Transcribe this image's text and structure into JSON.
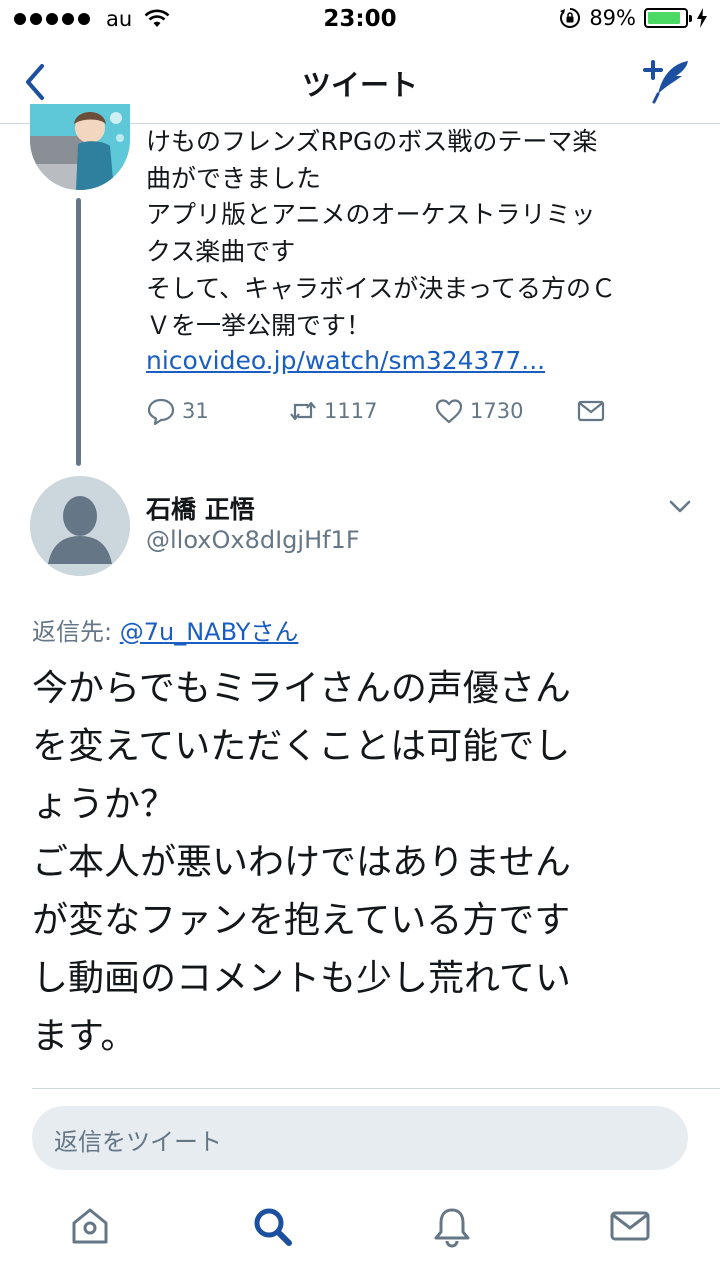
{
  "status_bar": {
    "carrier": "au",
    "time": "23:00",
    "battery_percent": "89%",
    "battery_level": 0.89,
    "icons": [
      "signal-dots",
      "wifi-icon",
      "rotation-lock-icon",
      "battery-icon",
      "charging-bolt-icon"
    ]
  },
  "nav": {
    "title": "ツイート",
    "back_icon": "chevron-left-icon",
    "compose_icon": "compose-tweet-icon"
  },
  "prev_tweet": {
    "text_lines": [
      "けものフレンズRPGのボス戦のテーマ楽",
      "曲ができました",
      "アプリ版とアニメのオーケストラリミッ",
      "クス楽曲です",
      "そして、キャラボイスが決まってる方のＣ",
      "Ｖを一挙公開です！"
    ],
    "link": "nicovideo.jp/watch/sm324377...",
    "reply_count": "31",
    "retweet_count": "1117",
    "like_count": "1730"
  },
  "main_tweet": {
    "display_name": "石橋 正悟",
    "handle": "@lloxOx8dIgjHf1F",
    "reply_to_label": "返信先:",
    "reply_to_user": "@7u_NABYさん",
    "body_lines": [
      "今からでもミライさんの声優さん",
      "を変えていただくことは可能でし",
      "ょうか？",
      "ご本人が悪いわけではありません",
      "が変なファンを抱えている方です",
      "し動画のコメントも少し荒れてい",
      "ます。"
    ]
  },
  "reply_box": {
    "placeholder": "返信をツイート"
  },
  "tab_bar": {
    "tabs": [
      "home-icon",
      "search-icon",
      "notifications-icon",
      "messages-icon"
    ],
    "active": "search-icon"
  },
  "colors": {
    "accent": "#1da1f2",
    "link": "#1b5ec2",
    "nav_blue": "#1c4fa0",
    "muted": "#657786",
    "reply_bg": "#e6ecf0"
  }
}
